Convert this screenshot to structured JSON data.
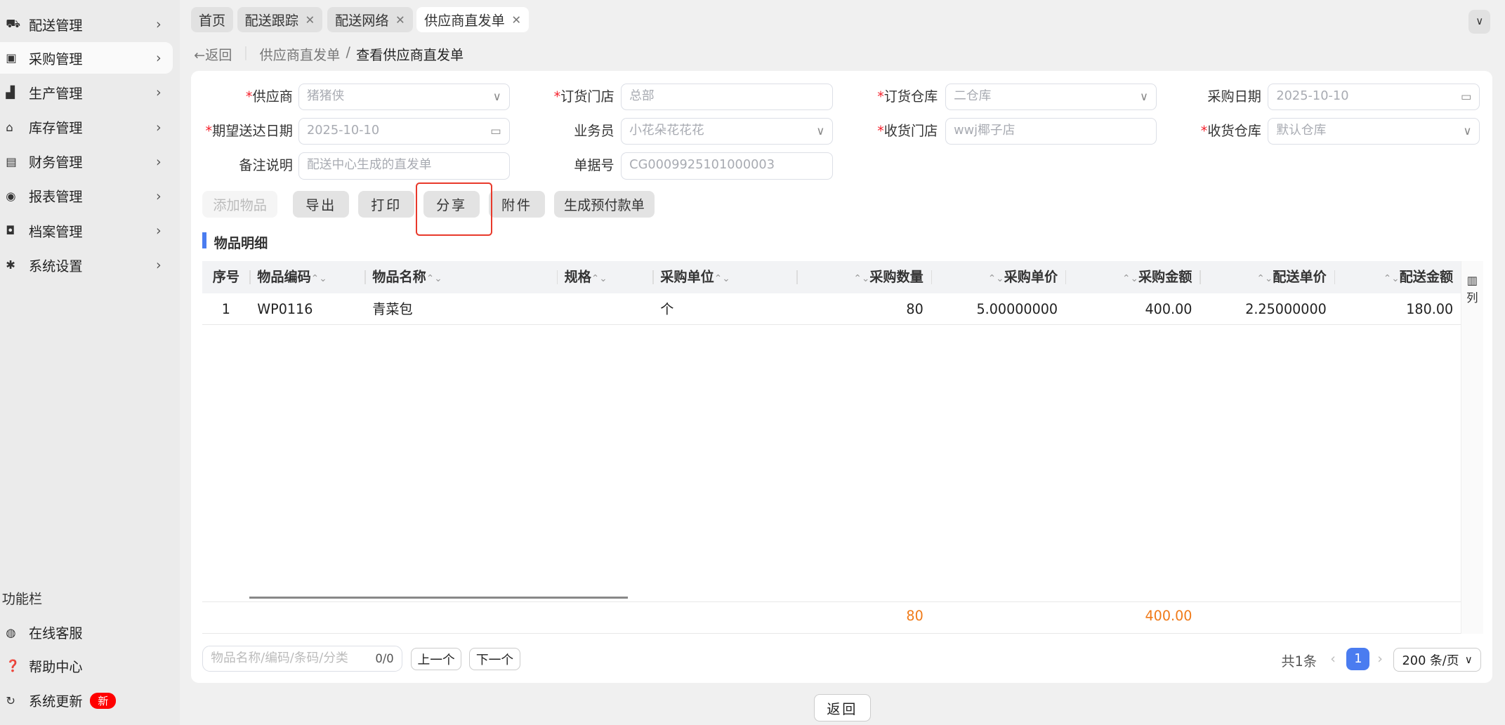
{
  "sidebar": {
    "items": [
      {
        "icon": "truck-icon",
        "label": "配送管理"
      },
      {
        "icon": "inbox-icon",
        "label": "采购管理"
      },
      {
        "icon": "factory-icon",
        "label": "生产管理"
      },
      {
        "icon": "warehouse-icon",
        "label": "库存管理"
      },
      {
        "icon": "finance-icon",
        "label": "财务管理"
      },
      {
        "icon": "globe-icon",
        "label": "报表管理"
      },
      {
        "icon": "archive-icon",
        "label": "档案管理"
      },
      {
        "icon": "gear-icon",
        "label": "系统设置"
      }
    ],
    "func_title": "功能栏",
    "func": [
      {
        "label": "在线客服"
      },
      {
        "label": "帮助中心"
      },
      {
        "label": "系统更新",
        "badge": "新"
      }
    ]
  },
  "tabs": [
    {
      "label": "首页"
    },
    {
      "label": "配送跟踪"
    },
    {
      "label": "配送网络"
    },
    {
      "label": "供应商直发单"
    }
  ],
  "breadcrumb": {
    "back": "返回",
    "parent": "供应商直发单",
    "current": "查看供应商直发单"
  },
  "form": {
    "supplier": {
      "label": "供应商",
      "value": "猪猪侠"
    },
    "order_store": {
      "label": "订货门店",
      "value": "总部"
    },
    "order_wh": {
      "label": "订货仓库",
      "value": "二仓库"
    },
    "purchase_date": {
      "label": "采购日期",
      "value": "2025-10-10"
    },
    "expected_date": {
      "label": "期望送达日期",
      "value": "2025-10-10"
    },
    "salesman": {
      "label": "业务员",
      "value": "小花朵花花花"
    },
    "recv_store": {
      "label": "收货门店",
      "value": "wwj椰子店"
    },
    "recv_wh": {
      "label": "收货仓库",
      "value": "默认仓库"
    },
    "remark": {
      "label": "备注说明",
      "value": "配送中心生成的直发单"
    },
    "doc_no": {
      "label": "单据号",
      "value": "CG0009925101000003"
    }
  },
  "actions": {
    "add": "添加物品",
    "export": "导出",
    "print": "打印",
    "share": "分享",
    "attach": "附件",
    "prepay": "生成预付款单"
  },
  "section_title": "物品明细",
  "table": {
    "columns": [
      "序号",
      "物品编码",
      "物品名称",
      "规格",
      "采购单位",
      "采购数量",
      "采购单价",
      "采购金额",
      "配送单价",
      "配送金额"
    ],
    "rows": [
      [
        "1",
        "WP0116",
        "青菜包",
        "",
        "个",
        "80",
        "5.00000000",
        "400.00",
        "2.25000000",
        "180.00"
      ]
    ],
    "col_setting": "列",
    "summary": {
      "qty": "80",
      "amount": "400.00"
    }
  },
  "footer": {
    "search_placeholder": "物品名称/编码/条码/分类",
    "count": "0/0",
    "prev": "上一个",
    "next": "下一个",
    "total": "共1条",
    "page": "1",
    "page_size": "200 条/页"
  },
  "back_button": "返回",
  "colors": {
    "accent": "#4a7cf0",
    "highlight": "#e8392b",
    "sum": "#f07a18"
  }
}
